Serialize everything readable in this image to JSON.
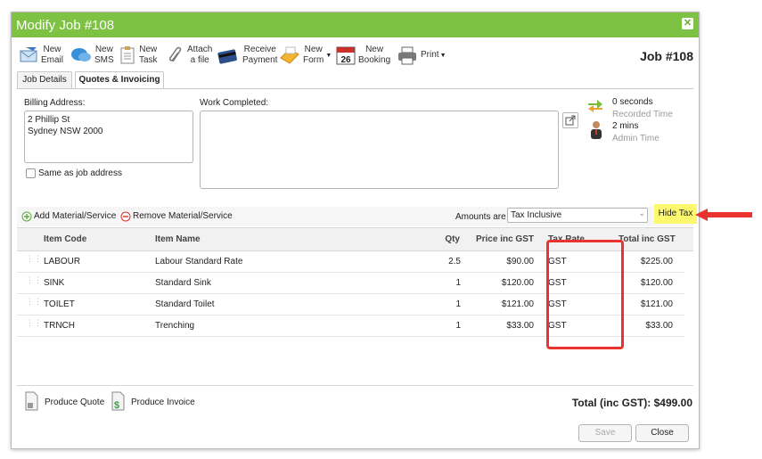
{
  "window": {
    "title": "Modify Job #108",
    "close_icon": "close-icon"
  },
  "toolbar": {
    "new_email": "New\nEmail",
    "new_sms": "New\nSMS",
    "new_task": "New\nTask",
    "attach_file": "Attach\na file",
    "receive_payment": "Receive\nPayment",
    "new_form": "New\nForm",
    "calendar_day": "26",
    "new_booking": "New\nBooking",
    "print": "Print"
  },
  "job_header": "Job #108",
  "tabs": [
    {
      "label": "Job Details",
      "active": false
    },
    {
      "label": "Quotes & Invoicing",
      "active": true
    }
  ],
  "billing": {
    "label": "Billing Address:",
    "line1": "2 Phillip St",
    "line2": "Sydney NSW 2000",
    "same_as_job_label": "Same as job address"
  },
  "work_completed": {
    "label": "Work Completed:",
    "value": ""
  },
  "time": {
    "recorded_value": "0 seconds",
    "recorded_label": "Recorded Time",
    "admin_value": "2 mins",
    "admin_label": "Admin Time"
  },
  "actions": {
    "add_material": "Add Material/Service",
    "remove_material": "Remove Material/Service",
    "amounts_are_label": "Amounts are",
    "amounts_are_value": "Tax Inclusive",
    "hide_tax": "Hide Tax"
  },
  "table": {
    "headers": {
      "item_code": "Item Code",
      "item_name": "Item Name",
      "qty": "Qty",
      "price": "Price inc GST",
      "tax_rate": "Tax Rate",
      "total": "Total inc GST"
    },
    "rows": [
      {
        "code": "LABOUR",
        "name": "Labour Standard Rate",
        "qty": "2.5",
        "price": "$90.00",
        "tax": "GST",
        "total": "$225.00"
      },
      {
        "code": "SINK",
        "name": "Standard Sink",
        "qty": "1",
        "price": "$120.00",
        "tax": "GST",
        "total": "$120.00"
      },
      {
        "code": "TOILET",
        "name": "Standard Toilet",
        "qty": "1",
        "price": "$121.00",
        "tax": "GST",
        "total": "$121.00"
      },
      {
        "code": "TRNCH",
        "name": "Trenching",
        "qty": "1",
        "price": "$33.00",
        "tax": "GST",
        "total": "$33.00"
      }
    ]
  },
  "footer": {
    "produce_quote": "Produce Quote",
    "produce_invoice": "Produce Invoice",
    "total": "Total (inc GST): $499.00",
    "save": "Save",
    "close": "Close"
  },
  "colors": {
    "titlebar": "#7dc242",
    "highlight": "#e8332f",
    "hide_tax_bg": "#fdf86e"
  }
}
